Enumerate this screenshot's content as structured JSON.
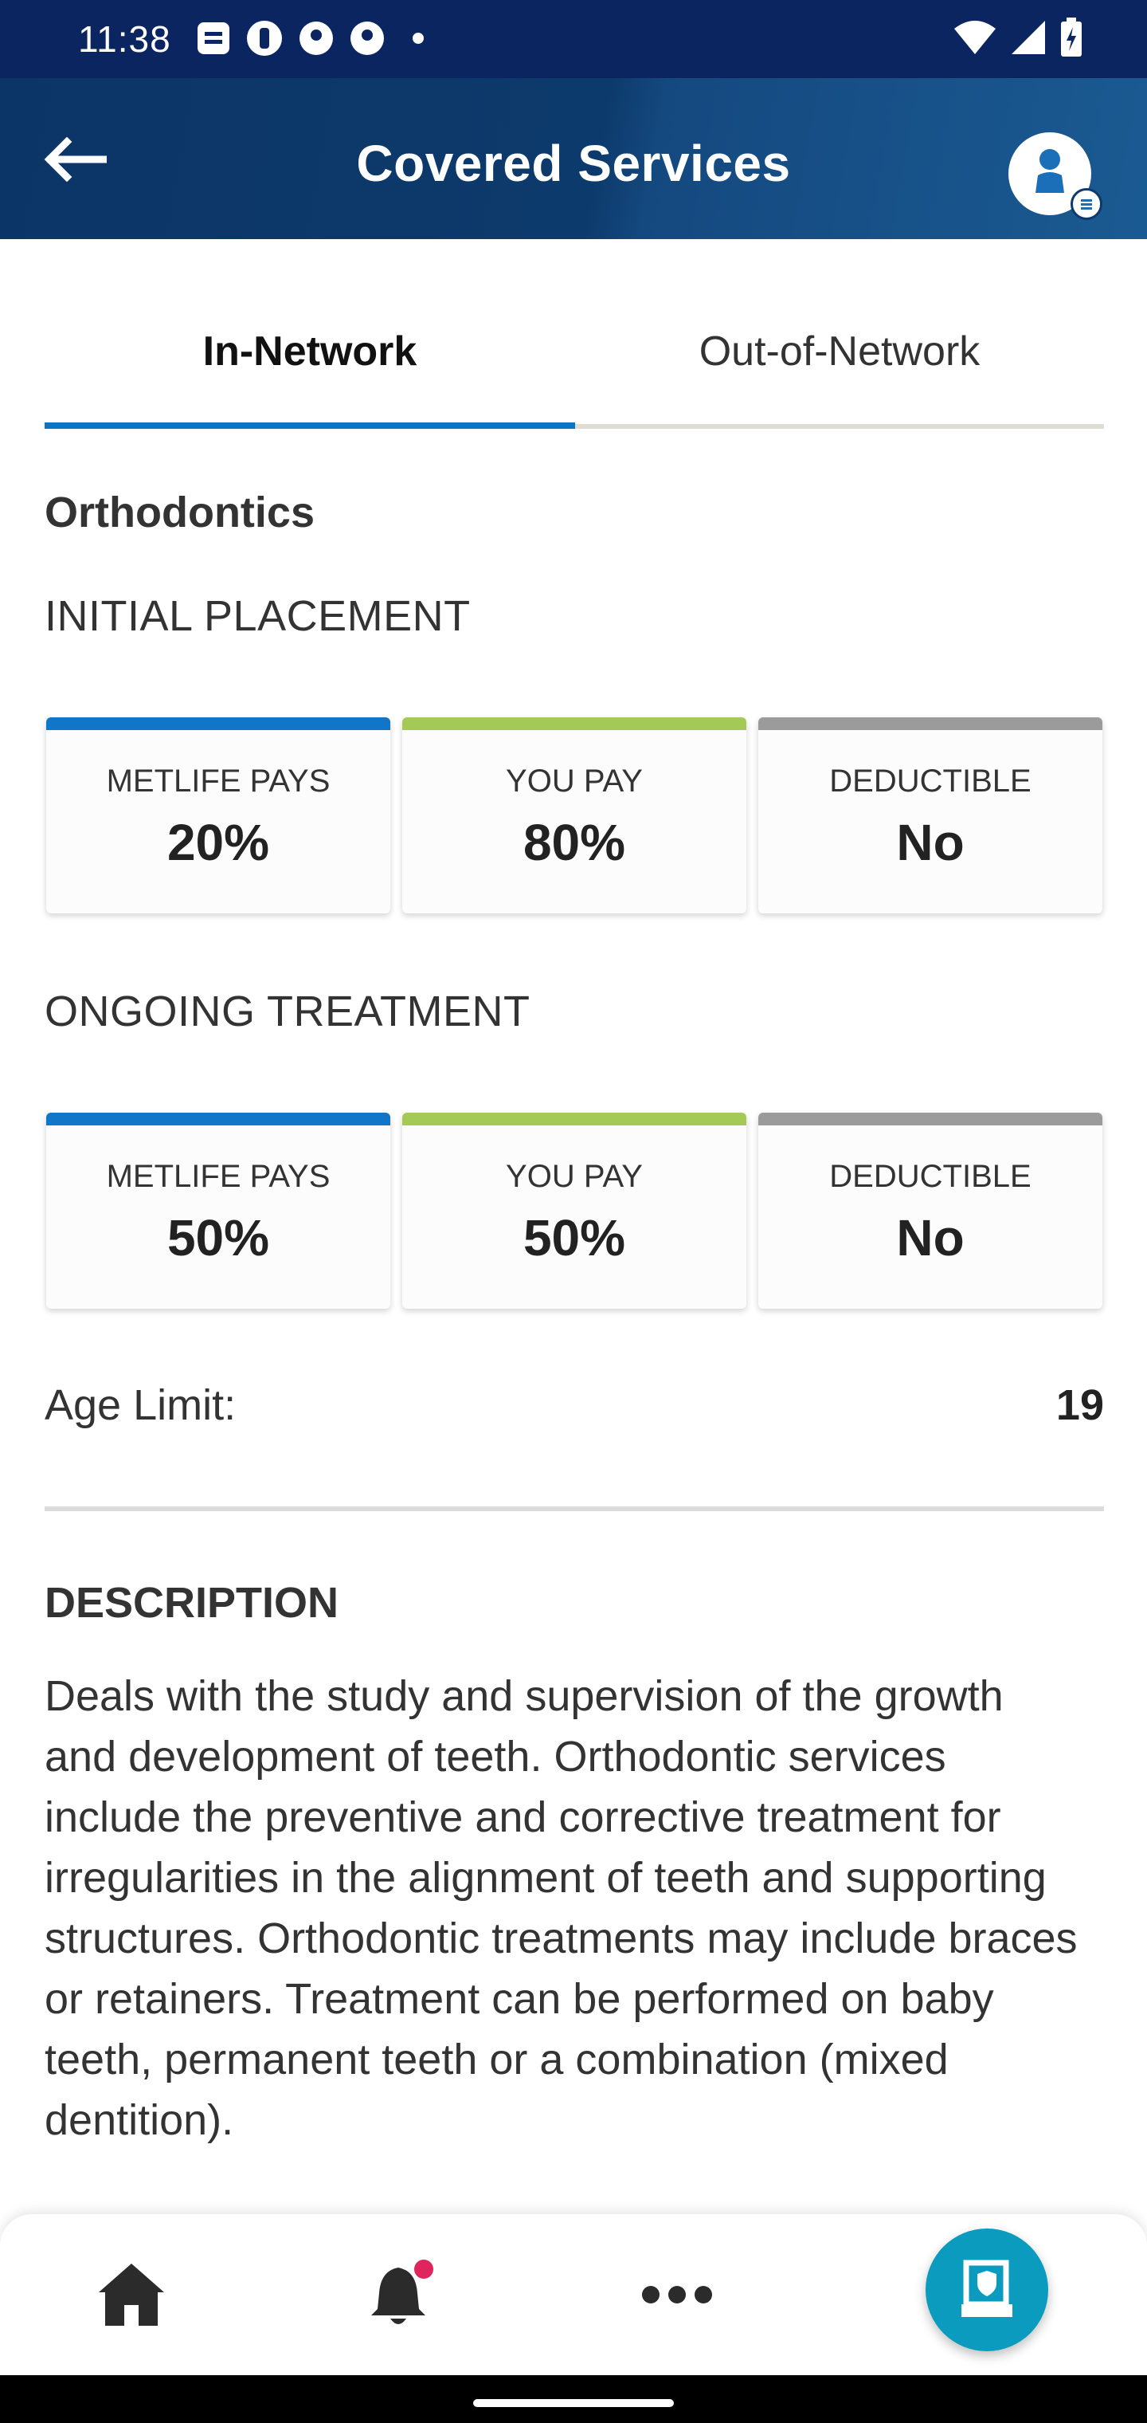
{
  "status_bar": {
    "time": "11:38",
    "notification_icons": [
      "message-icon",
      "app-icon",
      "p-icon",
      "p-icon",
      "dot-icon"
    ],
    "system_icons": [
      "wifi-icon",
      "signal-icon",
      "battery-icon"
    ]
  },
  "header": {
    "title": "Covered Services",
    "back_icon": "arrow-left-icon",
    "profile_icon": "profile-icon"
  },
  "tabs": [
    {
      "label": "In-Network",
      "active": true
    },
    {
      "label": "Out-of-Network",
      "active": false
    }
  ],
  "service": {
    "title": "Orthodontics",
    "sections": [
      {
        "title": "INITIAL PLACEMENT",
        "cards": [
          {
            "label": "METLIFE PAYS",
            "value": "20%",
            "color": "#1276c8"
          },
          {
            "label": "YOU PAY",
            "value": "80%",
            "color": "#a5c957"
          },
          {
            "label": "DEDUCTIBLE",
            "value": "No",
            "color": "#9b9b9b"
          }
        ]
      },
      {
        "title": "ONGOING TREATMENT",
        "cards": [
          {
            "label": "METLIFE PAYS",
            "value": "50%",
            "color": "#1276c8"
          },
          {
            "label": "YOU PAY",
            "value": "50%",
            "color": "#a5c957"
          },
          {
            "label": "DEDUCTIBLE",
            "value": "No",
            "color": "#9b9b9b"
          }
        ]
      }
    ],
    "age_limit_label": "Age Limit:",
    "age_limit_value": "19"
  },
  "description": {
    "title": "DESCRIPTION",
    "text": "Deals with the study and supervision of the growth and development of teeth. Orthodontic services include the preventive and corrective treatment for irregularities in the alignment of teeth and supporting structures. Orthodontic treatments may include braces or retainers. Treatment can be performed on baby teeth, permanent teeth or a combination (mixed dentition)."
  },
  "bottom_nav": {
    "items": [
      "home-icon",
      "bell-icon",
      "more-icon",
      "id-card-icon"
    ],
    "colors": {
      "nav_icon": "#2b2b2b",
      "alert_dot": "#e0245e",
      "fab": "#0a9bbf"
    }
  },
  "colors": {
    "status_bar": "#0b2561",
    "header": "#0d3a6c",
    "tab_active": "#0a76c4"
  }
}
